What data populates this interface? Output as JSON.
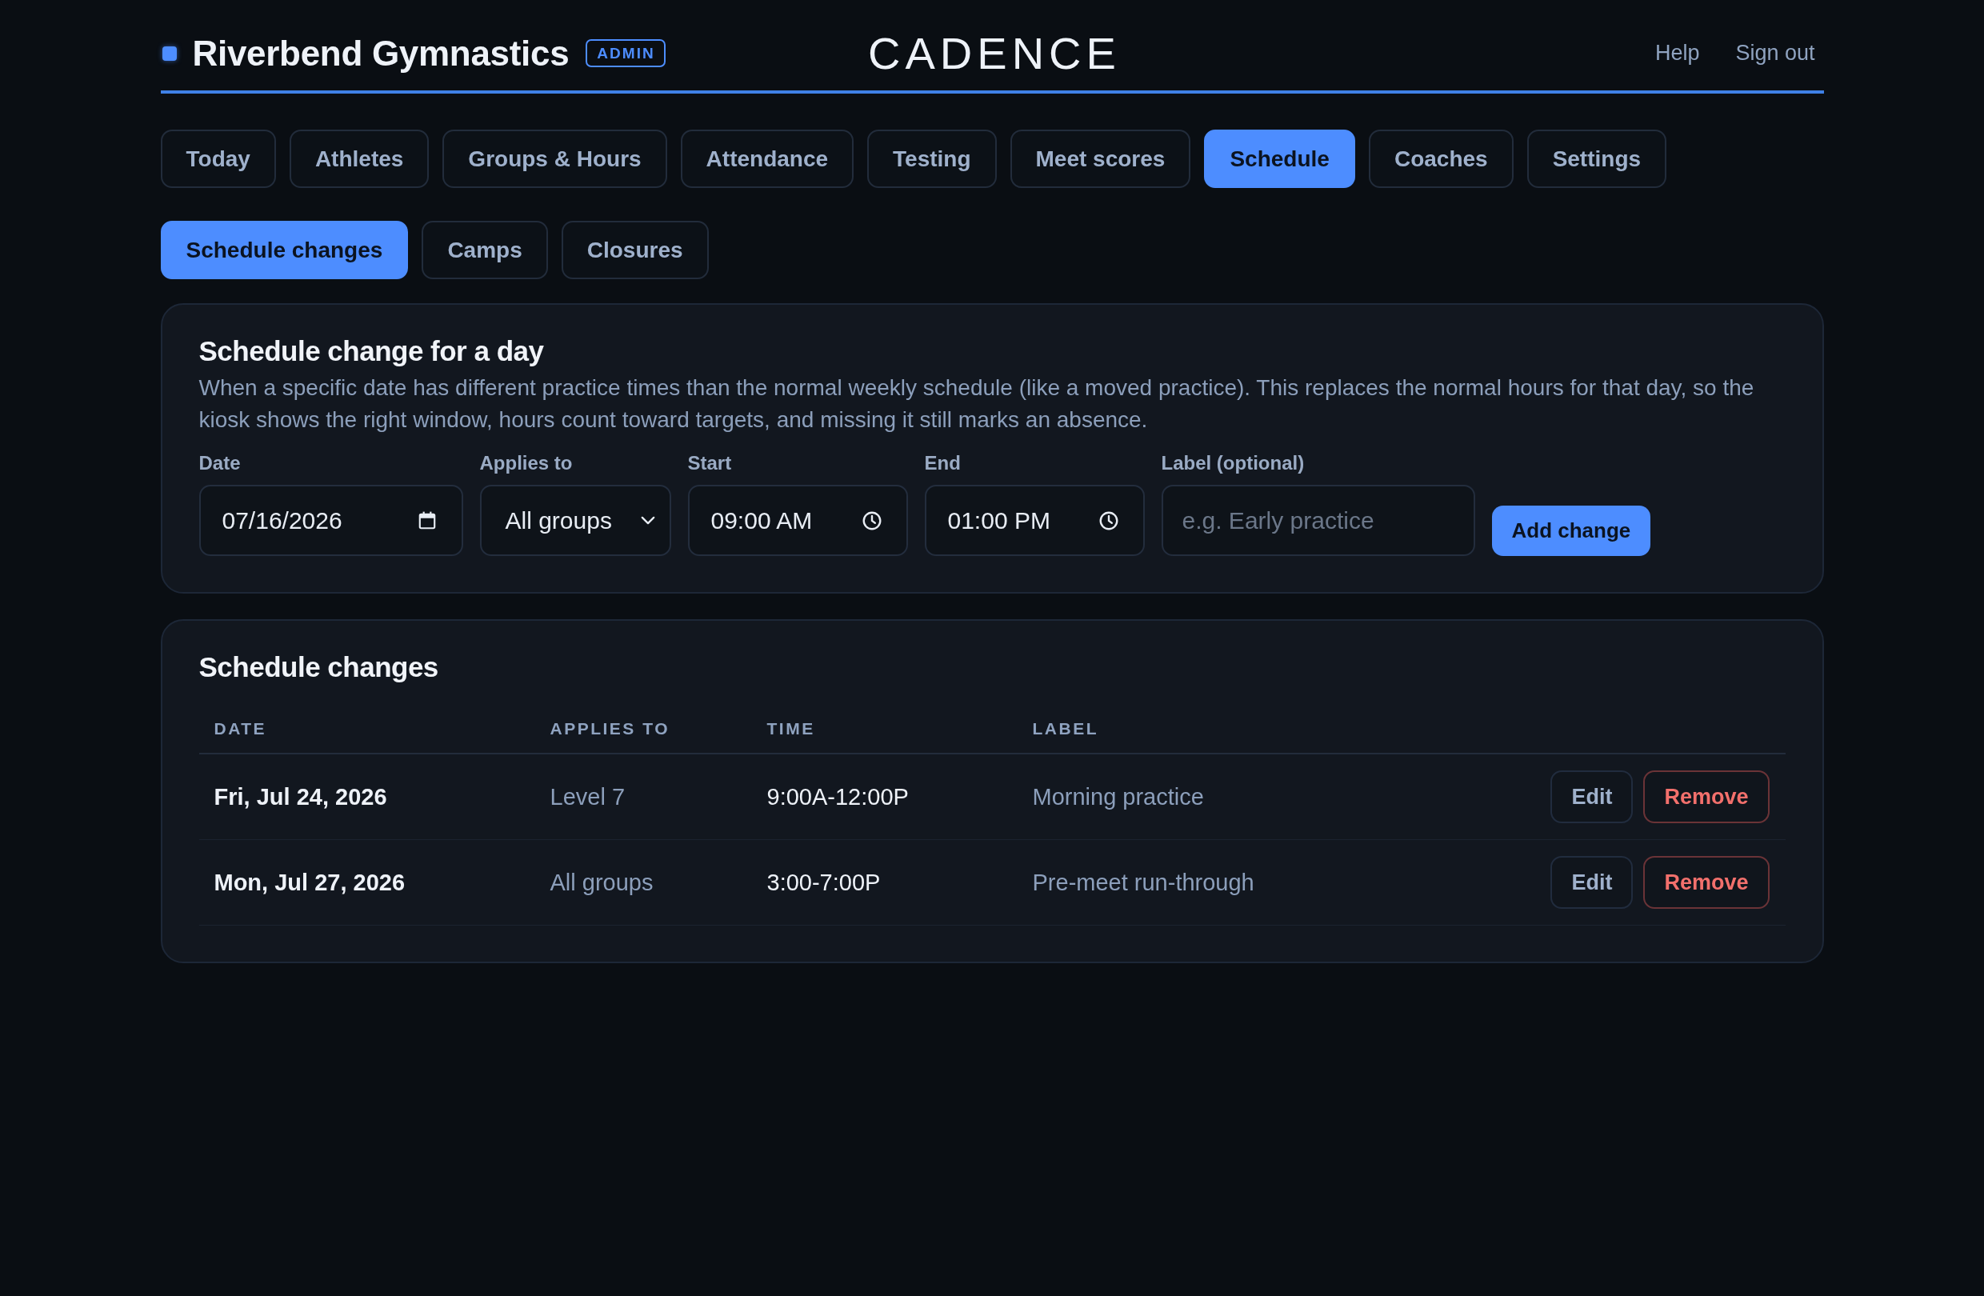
{
  "header": {
    "org_name": "Riverbend Gymnastics",
    "role_badge": "ADMIN",
    "logo": "CADENCE",
    "links": [
      "Help",
      "Sign out"
    ]
  },
  "tabs": [
    {
      "label": "Today",
      "selected": false
    },
    {
      "label": "Athletes",
      "selected": false
    },
    {
      "label": "Groups & Hours",
      "selected": false
    },
    {
      "label": "Attendance",
      "selected": false
    },
    {
      "label": "Testing",
      "selected": false
    },
    {
      "label": "Meet scores",
      "selected": false
    },
    {
      "label": "Schedule",
      "selected": true
    },
    {
      "label": "Coaches",
      "selected": false
    },
    {
      "label": "Settings",
      "selected": false
    }
  ],
  "subtabs": [
    {
      "label": "Schedule changes",
      "selected": true
    },
    {
      "label": "Camps",
      "selected": false
    },
    {
      "label": "Closures",
      "selected": false
    }
  ],
  "form_card": {
    "title": "Schedule change for a day",
    "description": "When a specific date has different practice times than the normal weekly schedule (like a moved practice). This replaces the normal hours for that day, so the kiosk shows the right window, hours count toward targets, and missing it still marks an absence.",
    "fields": [
      {
        "kind": "date",
        "label": "Date",
        "value": "07/16/2026"
      },
      {
        "kind": "select",
        "label": "Applies to",
        "value": "All groups"
      },
      {
        "kind": "time",
        "label": "Start",
        "value": "09:00 AM"
      },
      {
        "kind": "time",
        "label": "End",
        "value": "01:00 PM"
      },
      {
        "kind": "text",
        "label": "Label (optional)",
        "placeholder": "e.g. Early practice"
      }
    ],
    "submit_button": "Add change"
  },
  "list_card": {
    "title": "Schedule changes",
    "table": {
      "columns": [
        "DATE",
        "APPLIES TO",
        "TIME",
        "LABEL"
      ],
      "rows": [
        {
          "date": "Fri, Jul 24, 2026",
          "applies_to": "Level 7",
          "time": "9:00A-12:00P",
          "label": "Morning practice",
          "actions": [
            {
              "label": "Edit",
              "kind": "secondary"
            },
            {
              "label": "Remove",
              "kind": "danger"
            }
          ]
        },
        {
          "date": "Mon, Jul 27, 2026",
          "applies_to": "All groups",
          "time": "3:00-7:00P",
          "label": "Pre-meet run-through",
          "actions": [
            {
              "label": "Edit",
              "kind": "secondary"
            },
            {
              "label": "Remove",
              "kind": "danger"
            }
          ]
        }
      ]
    }
  }
}
